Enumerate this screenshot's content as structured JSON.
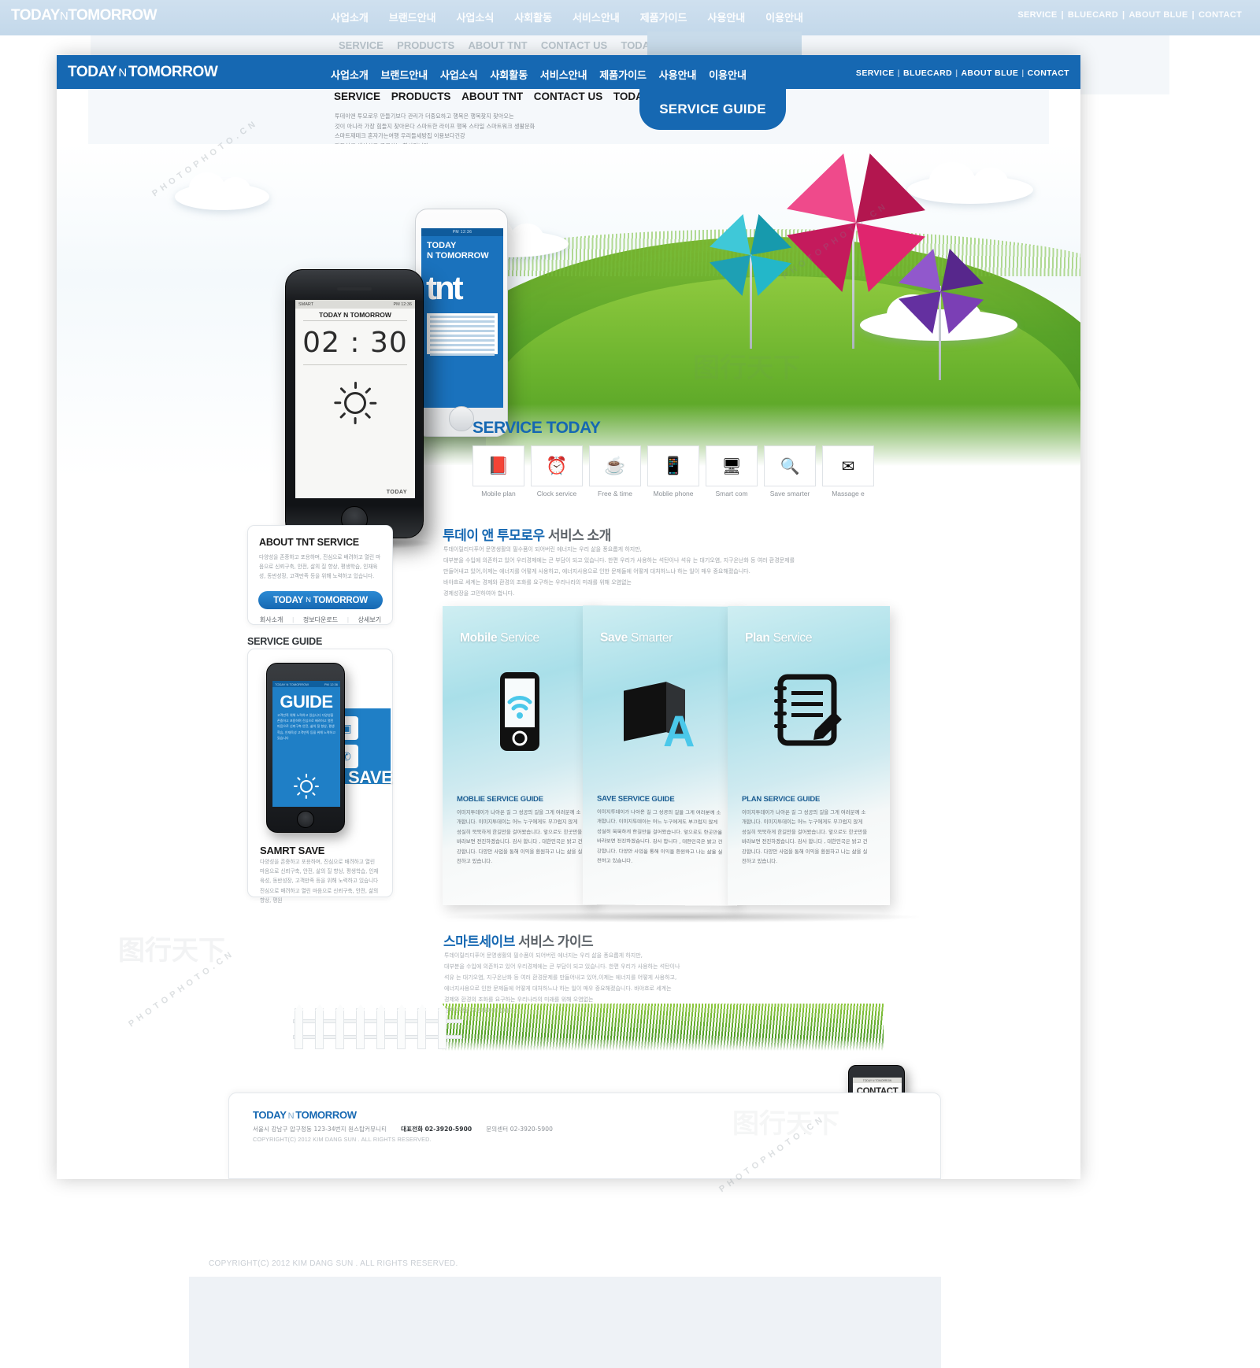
{
  "site": {
    "brand_first": "TODAY",
    "brand_mid": "N",
    "brand_last": "TOMORROW"
  },
  "header": {
    "gnb": [
      "사업소개",
      "브랜드안내",
      "사업소식",
      "사회활동",
      "서비스안내",
      "제품가이드",
      "사용안내",
      "이용안내"
    ],
    "utility": [
      "SERVICE",
      "BLUECARD",
      "ABOUT BLUE",
      "CONTACT"
    ],
    "utility_sep": "|"
  },
  "subnav": {
    "items": [
      "SERVICE",
      "PRODUCTS",
      "ABOUT TNT",
      "CONTACT US",
      "TODAY VISION"
    ],
    "tab_label": "SERVICE GUIDE",
    "intro_lines": [
      "투데이앤 투모로우 만들기보다 관리가 더중요하고 행복은 행복찾지 찾아오는",
      "것이 아니라 가장 힘들지 찾아온다  스마트한 라이프 행복 스타일 스마트워크 생활문화",
      "스마트재테크 혼자가는여행  우리들세방집 이용보다건강",
      "자동차를 생산하고 공급하는 회사입니다."
    ]
  },
  "hero": {
    "phone_black": {
      "status_left": "SMART",
      "status_right": "PM 12:36",
      "title": "TODAY N TOMORROW",
      "clock": "02 : 30",
      "footer_label": "TODAY",
      "weather_icon": "sun-icon"
    },
    "phone_white": {
      "status": "PM 12:36",
      "title_line1": "TODAY",
      "title_line2": "N TOMORROW",
      "logo_text": "tnt"
    }
  },
  "service_today": {
    "heading": "SERVICE TODAY",
    "items": [
      {
        "label": "Mobile plan",
        "icon": "book-magnifier-icon",
        "glyph": "📕"
      },
      {
        "label": "Clock service",
        "icon": "alarm-clock-icon",
        "glyph": "⏰"
      },
      {
        "label": "Free & time",
        "icon": "coffee-cup-icon",
        "glyph": "☕"
      },
      {
        "label": "Moblie phone",
        "icon": "smartphone-icon",
        "glyph": "📱"
      },
      {
        "label": "Smart com",
        "icon": "desktop-monitor-icon",
        "glyph": "🖥"
      },
      {
        "label": "Save smarter",
        "icon": "power-search-icon",
        "glyph": "🔍"
      },
      {
        "label": "Massage e",
        "icon": "envelope-mail-icon",
        "glyph": "✉"
      }
    ]
  },
  "about_card": {
    "title": "ABOUT TNT SERVICE",
    "body": "다양성을 존중하고 포용하며, 진심으로 배려하고 열린 마음으로 신뢰구축, 안전, 삶의 질 향상, 평생학습, 인재육성, 동반성장, 고객만족 등을 위해 노력하고 있습니다.",
    "button": {
      "first": "TODAY",
      "mid": "N",
      "last": "TOMORROW"
    },
    "links": [
      "회사소개",
      "정보다운로드",
      "상세보기"
    ],
    "link_sep": "|"
  },
  "service_guide": {
    "section_title": "SERVICE GUIDE",
    "phone": {
      "status_left": "TODAY N TOMORROW",
      "status_right": "PM 12:36",
      "screen_title": "GUIDE",
      "screen_body": "고객만족 위해 노력하고 있습니다 다양성을 존중하고 포용하며 진심으로 배려하고 열린 마음으로 신뢰구축 안전, 삶의 질 향상, 평생학습, 인재육성 고객만족 등을 위해 노력하고 있습니다",
      "sun_icon": "sun-icon"
    },
    "tile_icons": [
      "calendar-icon",
      "message-icon",
      "chart-icon",
      "phone-icon"
    ],
    "save_word": "SAVE",
    "heading": "SAMRT SAVE",
    "body": "다양성을 존중하고 포용하며, 진심으로 배려하고 열린 마음으로 신뢰구축, 안전, 삶의 질 향상, 평생학습, 인재육성, 동반성장, 고객만족 등을 위해 노력하고 있습니다 진심으로 배려하고 열린 마음으로 신뢰구축, 안전, 삶의 향상, 평원"
  },
  "intro": {
    "title_strong": "투데이 앤 투모로우",
    "title_rest": "서비스 소개",
    "lines": [
      "투데이릴리디푸어 문명생활의 필수품이 되어버린 에너지는 우리 삶을 풍요롭게 하지만,",
      "대부분을 수입에 의존하고 있어 우리경제에는 큰 부담이 되고 있습니다. 한편 우리가 사용하는 석탄이나 석유 는 대기오염, 지구온난화 등 여러 환경문제를",
      "만들어내고 있어,이제는 에너지를 어떻게 사용하고, 에너지사용으로 인한 문제들에  어떻게 대처하느냐 하는 일이 매우 중요해졌습니다.",
      "바야흐로 세계는 경제와 환경의 조화를 요구하는  우리나라의 미래를 위해 오염없는",
      "경제성장을 고민하여야 합니다."
    ]
  },
  "brochure": {
    "panels": [
      {
        "title_strong": "Mobile",
        "title_rest": "Service",
        "icon": "smartphone-wifi-icon",
        "heading": "MOBLIE SERVICE GUIDE",
        "body": "이미지투데이가 나아온 길 그 성공의 길을 그게 여러분께 소개합니다. 이미지투데이는 어느 누구에게도 부끄럽지 않게 성실히 묵묵하게 한길만을 걸어왔습니다. 앞으로도 한곳만을 바라보면 전진하겠습니다. 감사 합니다 , 대한민국은 밝고 건강합니다. 다양안 사업을 통해 이익을 환원하고 나는 삶을 실천하고 있습니다."
      },
      {
        "title_strong": "Save",
        "title_rest": "Smarter",
        "icon": "book-letter-a-icon",
        "heading": "SAVE SERVICE GUIDE",
        "body": "이미지투데이가 나아온 길 그 성공의 길을 그게 여러분께 소개합니다. 이미지투데이는 어느 누구에게도 부끄럽지 않게 성실히 묵묵하게 한길만을 걸어왔습니다. 앞으로도 한곳만을 바라보면 전진하겠습니다. 감사 합니다 , 대한민국은 밝고 건강합니다. 다양안 사업을 통해 이익을 환원하고 나는 삶을 실천하고 있습니다."
      },
      {
        "title_strong": "Plan",
        "title_rest": "Service",
        "icon": "notebook-pencil-icon",
        "heading": "PLAN SERVICE GUIDE",
        "body": "이미지투데이가 나아온 길 그 성공의 길을 그게 여러분께 소개합니다. 이미지투데이는 어느 누구에게도 부끄럽지 않게 성실히 묵묵하게 한길만을 걸어왔습니다. 앞으로도 한곳만을 바라보면 전진하겠습니다. 감사 합니다 , 대한민국은 밝고 건강합니다. 다양안 사업을 통해 이익을 환원하고 나는 삶을 실천하고 있습니다."
      }
    ]
  },
  "smart_save": {
    "title_strong": "스마트세이브",
    "title_rest": "서비스 가이드",
    "lines": [
      "투데이릴리디푸어 문명생활의 필수품이 되어버린 에너지는 우리 삶을 풍요롭게 하지만,",
      "대부분을  수입에 의존하고 있어 우리경제에는 큰 부담이 되고 있습니다. 한편 우리가 사용하는 석탄이나",
      "석유 는 대기오염, 지구온난화 등 여러 환경문제를 만들어내고 있어,이제는 에너지를 어떻게 사용하고,",
      "에너지사용으로 인한 문제들에  어떻게 대처하느냐 하는 일이 매우 중요해졌습니다.  바야흐로 세계는",
      "경제와 환경의 조화를 요구하는  우리나라의 미래를 위해 오염없는",
      "경제성장을 고민하여야 합니다."
    ]
  },
  "contact_phone": {
    "status": "TODAY N TOMORROW",
    "label": "CONTACT",
    "icon": "phone-call-icon"
  },
  "footer": {
    "brand_first": "TODAY",
    "brand_mid": "N",
    "brand_last": "TOMORROW",
    "address": "서울시 강남구 압구정동 123-34번지  원스탑커뮤니티",
    "tel_label": "대표전화",
    "tel": "02-3920-5900",
    "center_label": "문의센터",
    "center_tel": "02-3920-5900",
    "copyright": "COPYRIGHT(C) 2012 KIM DANG SUN . ALL RIGHTS RESERVED."
  },
  "watermark": {
    "text": "PHOTOPHOTO.CN",
    "cn": "图行天下"
  },
  "colors": {
    "brand_blue": "#1668b2",
    "accent_blue": "#2b8ad4",
    "grass_green": "#5aa52a",
    "pinwheel_pink": "#e0256e",
    "pinwheel_cyan": "#23b7c9",
    "pinwheel_purple": "#7b3fb5"
  }
}
